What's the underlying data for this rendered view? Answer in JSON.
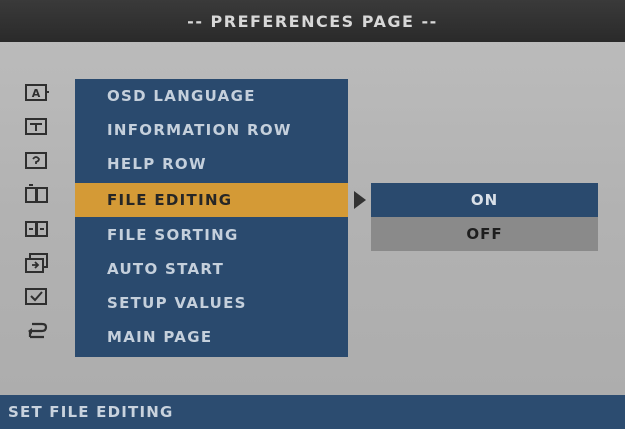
{
  "header": {
    "title": "-- PREFERENCES PAGE --"
  },
  "menu": {
    "items": [
      {
        "label": "OSD LANGUAGE",
        "icon": "language-icon"
      },
      {
        "label": "INFORMATION ROW",
        "icon": "info-row-icon"
      },
      {
        "label": "HELP ROW",
        "icon": "help-row-icon"
      },
      {
        "label": "FILE EDITING",
        "icon": "file-edit-icon",
        "selected": true
      },
      {
        "label": "FILE SORTING",
        "icon": "file-sort-icon"
      },
      {
        "label": "AUTO START",
        "icon": "auto-start-icon"
      },
      {
        "label": "SETUP VALUES",
        "icon": "setup-values-icon"
      },
      {
        "label": "MAIN PAGE",
        "icon": "back-icon"
      }
    ]
  },
  "submenu": {
    "options": [
      {
        "label": "ON",
        "highlighted": true
      },
      {
        "label": "OFF",
        "highlighted": false
      }
    ]
  },
  "status": {
    "text": "SET FILE EDITING"
  },
  "colors": {
    "panel": "#2a4a6e",
    "selected": "#d49a36",
    "background": "#b3b3b3",
    "title_bar": "#2e2e2e"
  }
}
